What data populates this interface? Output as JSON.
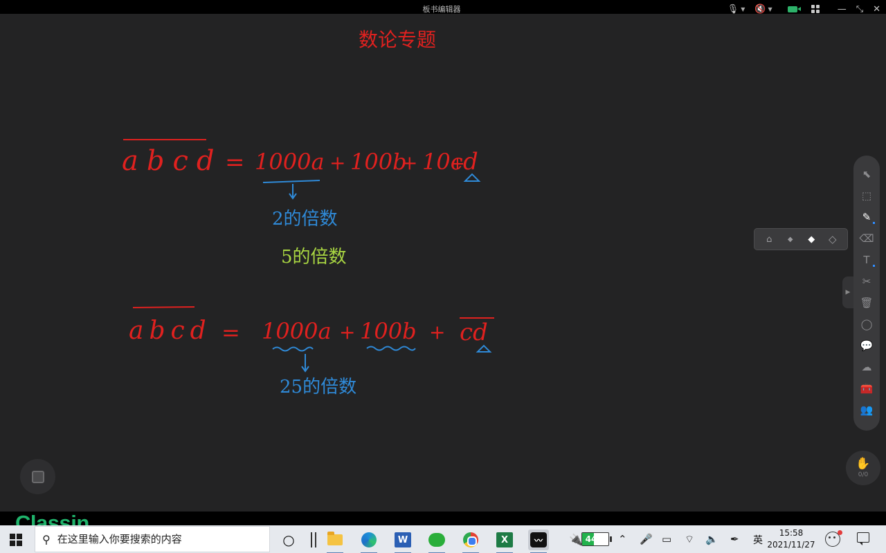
{
  "window": {
    "title": "板书编辑器",
    "controls": {
      "mic_icon": "microphone-icon",
      "speaker_icon": "speaker-muted-icon",
      "camera_icon": "camera-icon",
      "layout_icon": "grid-layout-icon",
      "minimize": "—",
      "restore": "⤡",
      "close": "✕"
    }
  },
  "board": {
    "title_handwritten": "数论专题",
    "eq1": {
      "lhs": "abcd",
      "rhs_terms": [
        "1000a",
        "+",
        "100b",
        "+",
        "10c",
        "+",
        "d"
      ],
      "note_blue": "2的倍数",
      "note_green": "5的倍数"
    },
    "eq2": {
      "lhs": "abcd",
      "rhs_terms": [
        "1000a",
        "+",
        "100b",
        "+",
        "cd"
      ],
      "note_blue": "25的倍数"
    },
    "colors": {
      "background": "#232324",
      "red_ink": "#e0211f",
      "blue_ink": "#2f8ad8",
      "green_ink": "#a9d642"
    }
  },
  "toolbar": {
    "tools": [
      {
        "name": "pointer-tool",
        "icon": "⬉",
        "active": false,
        "dot": false
      },
      {
        "name": "select-tool",
        "icon": "⬚",
        "active": false,
        "dot": false
      },
      {
        "name": "pen-tool",
        "icon": "✎",
        "active": true,
        "dot": true
      },
      {
        "name": "eraser-tool",
        "icon": "⌫",
        "active": false,
        "dot": false
      },
      {
        "name": "text-tool",
        "icon": "T",
        "active": false,
        "dot": true
      },
      {
        "name": "scissors-tool",
        "icon": "✂",
        "active": false,
        "dot": false
      },
      {
        "name": "trash-tool",
        "icon": "🗑",
        "active": false,
        "dot": false
      },
      {
        "name": "shape-tool",
        "icon": "◯",
        "active": false,
        "dot": false
      },
      {
        "name": "chat-tool",
        "icon": "💬",
        "active": false,
        "dot": false
      },
      {
        "name": "cloud-tool",
        "icon": "☁",
        "active": false,
        "dot": false
      },
      {
        "name": "toolbox-tool",
        "icon": "🧰",
        "active": false,
        "dot": false
      },
      {
        "name": "members-tool",
        "icon": "👥",
        "active": false,
        "dot": false
      }
    ],
    "eraser_options": [
      "broom-icon",
      "small-eraser-icon",
      "medium-eraser-icon",
      "large-eraser-icon"
    ],
    "hand_raise_count": "0/0"
  },
  "watermark": "Classin",
  "taskbar": {
    "search_placeholder": "在这里输入你要搜索的内容",
    "apps": [
      "cortana",
      "task-view",
      "file-explorer",
      "edge",
      "word",
      "wechat",
      "chrome",
      "excel",
      "classin"
    ],
    "battery_percent": "44%",
    "battery_level": 0.44,
    "ime": "英",
    "time": "15:58",
    "date": "2021/11/27"
  }
}
